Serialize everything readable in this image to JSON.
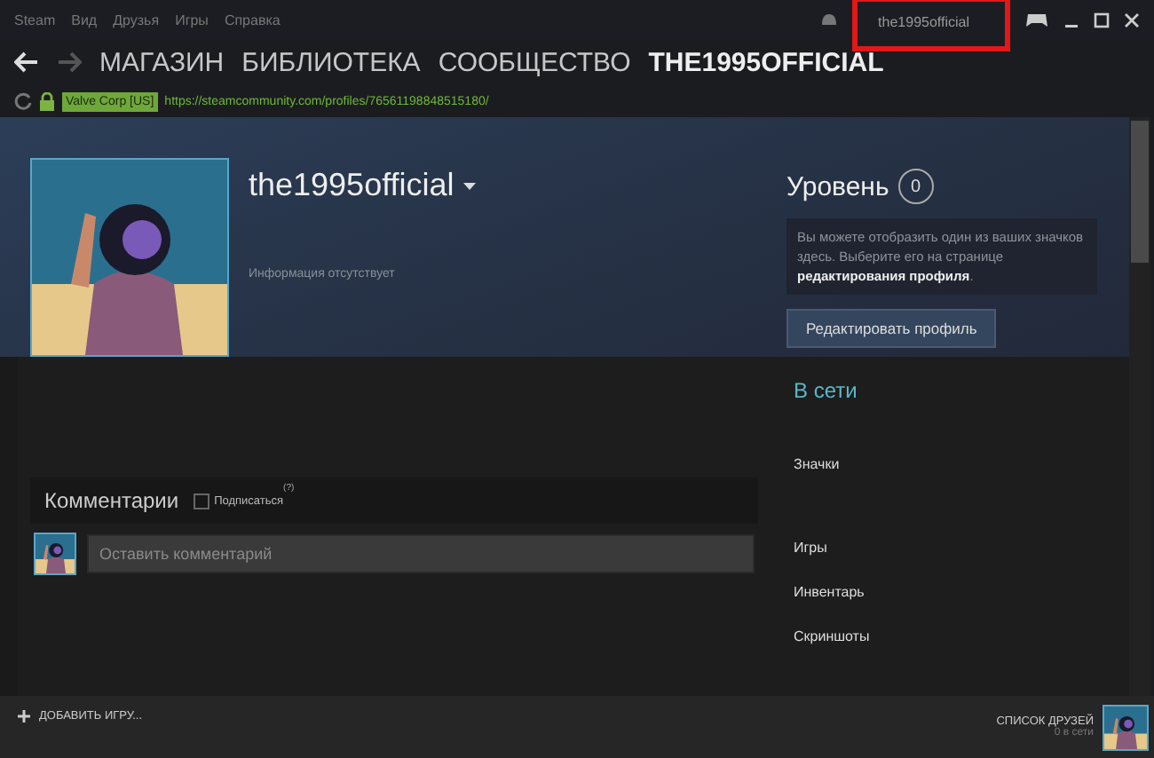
{
  "menu_bar": {
    "items": [
      "Steam",
      "Вид",
      "Друзья",
      "Игры",
      "Справка"
    ],
    "account": {
      "name": "the1995official",
      "highlighted": true
    }
  },
  "nav": {
    "tabs": [
      {
        "label": "МАГАЗИН",
        "selected": false
      },
      {
        "label": "БИБЛИОТЕКА",
        "selected": false
      },
      {
        "label": "СООБЩЕСТВО",
        "selected": false
      },
      {
        "label": "THE1995OFFICIAL",
        "selected": true
      }
    ]
  },
  "address_bar": {
    "certificate": "Valve Corp [US]",
    "url": "https://steamcommunity.com/profiles/76561198848515180/"
  },
  "profile": {
    "name": "the1995official",
    "summary": "Информация отсутствует",
    "level_label": "Уровень",
    "level": "0",
    "badge_hint": "Вы можете отобразить один из ваших значков здесь. Выберите его на странице **редактирования профиля**.",
    "edit_button": "Редактировать профиль"
  },
  "comments": {
    "title": "Комментарии",
    "subscribe": {
      "label": "Подписаться",
      "checked": false
    },
    "help": "(?)",
    "placeholder": "Оставить комментарий"
  },
  "sidebar": {
    "status": "В сети",
    "groups": [
      {
        "items": [
          "Значки"
        ]
      },
      {
        "items": [
          "Игры",
          "Инвентарь",
          "Скриншоты"
        ]
      }
    ]
  },
  "bottom_bar": {
    "add_game": "ДОБАВИТЬ ИГРУ...",
    "friends_title": "СПИСОК ДРУЗЕЙ",
    "friends_online": "0 в сети"
  }
}
